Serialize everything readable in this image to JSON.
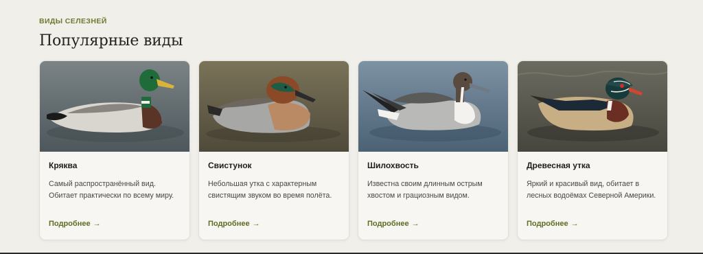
{
  "section": {
    "eyebrow": "ВИДЫ СЕЛЕЗНЕЙ",
    "title": "Популярные виды"
  },
  "cards": [
    {
      "name": "Кряква",
      "description": "Самый распространённый вид. Обитает практически по всему миру.",
      "link": "Подробнее",
      "arrow_icon": "arrow-right-icon",
      "image": "mallard-drake-photo",
      "colors": {
        "water": "#5f6a70",
        "head": "#1f6b3a",
        "bill": "#d8b43a",
        "breast": "#5a3426",
        "body": "#d9d6d0"
      }
    },
    {
      "name": "Свистунок",
      "description": "Небольшая утка с характерным свистящим звуком во время полёта.",
      "link": "Подробнее",
      "arrow_icon": "arrow-right-icon",
      "image": "teal-drake-photo",
      "colors": {
        "water": "#6b6750",
        "head": "#8a4a28",
        "bill": "#2a2a2a",
        "breast": "#b98a63",
        "body": "#a7a8a6"
      }
    },
    {
      "name": "Шилохвость",
      "description": "Известна своим длинным острым хвостом и грациозным видом.",
      "link": "Подробнее",
      "arrow_icon": "arrow-right-icon",
      "image": "pintail-drake-photo",
      "colors": {
        "water": "#5d7488",
        "head": "#5a4b40",
        "bill": "#6f7a86",
        "breast": "#f3f2ee",
        "body": "#b9bab8"
      }
    },
    {
      "name": "Древесная утка",
      "description": "Яркий и красивый вид, обитает в лесных водоёмах Северной Америки.",
      "link": "Подробнее",
      "arrow_icon": "arrow-right-icon",
      "image": "wood-duck-drake-photo",
      "colors": {
        "water": "#5a5a50",
        "head": "#173b3a",
        "bill": "#d2452f",
        "breast": "#6a2f22",
        "body": "#c8ae85"
      }
    }
  ]
}
